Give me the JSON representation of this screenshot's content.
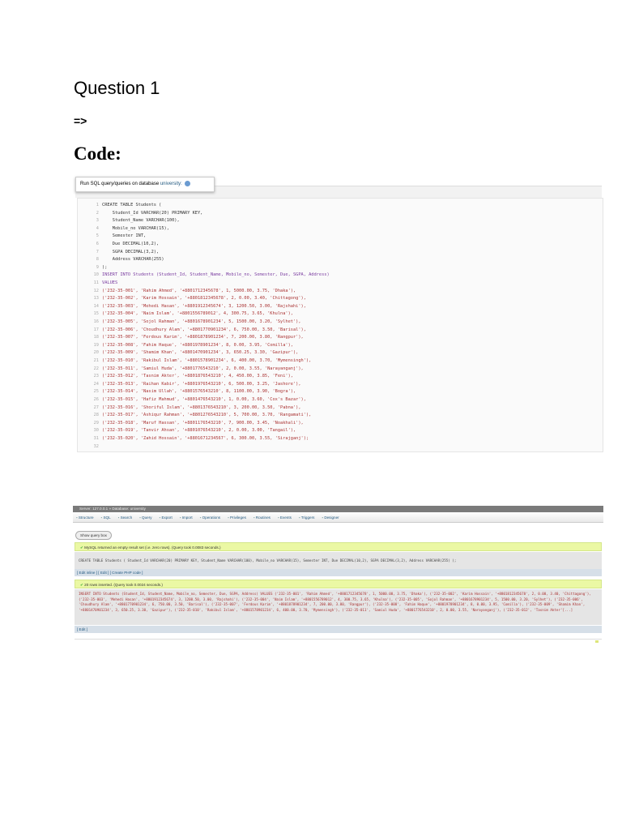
{
  "heading": "Question 1",
  "arrow": "=>",
  "code_heading": "Code:",
  "sql_panel": {
    "label": "Run SQL query/queries on database ",
    "db": "university:",
    "lines": [
      "CREATE TABLE Students (",
      "    Student_Id VARCHAR(20) PRIMARY KEY,",
      "    Student_Name VARCHAR(100),",
      "    Mobile_no VARCHAR(15),",
      "    Semester INT,",
      "    Due DECIMAL(10,2),",
      "    SGPA DECIMAL(3,2),",
      "    Address VARCHAR(255)",
      ");",
      "INSERT INTO Students (Student_Id, Student_Name, Mobile_no, Semester, Due, SGPA, Address)",
      "VALUES",
      "('232-35-001', 'Rahim Ahmed', '+8801712345678', 1, 5000.00, 3.75, 'Dhaka'),",
      "('232-35-002', 'Karim Hossain', '+8801812345678', 2, 0.00, 3.40, 'Chittagong'),",
      "('232-35-003', 'Mehedi Hasan', '+8801912345674', 3, 1200.50, 3.00, 'Rajshahi'),",
      "('232-35-004', 'Naim Islam', '+8801556789012', 4, 300.75, 3.65, 'Khulna'),",
      "('232-35-005', 'Sojol Rahman', '+8801678901234', 5, 1500.00, 3.20, 'Sylhet'),",
      "('232-35-006', 'Choudhury Alam', '+8801770901234', 6, 750.00, 3.50, 'Barisal'),",
      "('232-35-007', 'Ferdous Karim', '+8801878901234', 7, 200.00, 3.80, 'Rangpur'),",
      "('232-35-008', 'Fahim Haque', '+8801978901234', 8, 0.00, 3.95, 'Comilla'),",
      "('232-35-009', 'Shamim Khan', '+8801470901234', 3, 650.25, 3.30, 'Gazipur'),",
      "('232-35-010', 'Rakibul Islam', '+8801578901234', 6, 400.00, 3.70, 'Mymensingh'),",
      "('232-35-011', 'Samiul Huda', '+8801776543210', 2, 0.00, 3.55, 'Narayanganj'),",
      "('232-35-012', 'Tasnim Akter', '+8801876543210', 4, 450.00, 3.85, 'Feni'),",
      "('232-35-013', 'Raihan Kabir', '+8801976543210', 6, 500.00, 3.25, 'Jashore'),",
      "('232-35-014', 'Nasim Ullah', '+8801576543210', 8, 1100.00, 3.90, 'Bogra'),",
      "('232-35-015', 'Hafiz Mahmud', '+8801476543210', 1, 0.00, 3.60, 'Cox's Bazar'),",
      "('232-35-016', 'Shoriful Islam', '+8801376543210', 3, 200.00, 3.50, 'Pabna'),",
      "('232-35-017', 'Ashiqur Rahman', '+8801276543210', 5, 700.00, 3.70, 'Rangamati'),",
      "('232-35-018', 'Maruf Hassan', '+8801176543210', 7, 900.00, 3.45, 'Noakhali'),",
      "('232-35-019', 'Tanvir Ahsan', '+8801076543210', 2, 0.00, 3.00, 'Tangail'),",
      "('232-35-020', 'Zahid Hossain', '+8801671234567', 6, 300.00, 3.55, 'Sirajganj');",
      ""
    ]
  },
  "result_panel": {
    "title_bar": "Server: 127.0.0.1 » Database: university",
    "tabs": [
      "Structure",
      "SQL",
      "Search",
      "Query",
      "Export",
      "Import",
      "Operations",
      "Privileges",
      "Routines",
      "Events",
      "Triggers",
      "Designer"
    ],
    "show_query_box": "Show query box",
    "msg1": "MySQL returned an empty result set (i.e. zero rows). (Query took 0.0083 seconds.)",
    "create_sql": "CREATE TABLE Students ( Student_Id VARCHAR(20) PRIMARY KEY, Student_Name VARCHAR(100), Mobile_no VARCHAR(15), Semester INT, Due DECIMAL(10,2), SGPA DECIMAL(3,2), Address VARCHAR(255) );",
    "links1": "[ Edit inline ] [ Edit ] [ Create PHP code ]",
    "msg2": "20 rows inserted. (Query took 0.0024 seconds.)",
    "insert_sql": "INSERT INTO Students (Student_Id, Student_Name, Mobile_no, Semester, Due, SGPA, Address) VALUES ('232-35-001', 'Rahim Ahmed', '+8801712345678', 1, 5000.00, 3.75, 'Dhaka'), ('232-35-002', 'Karim Hossain', '+8801812345678', 2, 0.00, 3.40, 'Chittagong'), ('232-35-003', 'Mehedi Hasan', '+8801912345674', 3, 1200.50, 3.00, 'Rajshahi'), ('232-35-004', 'Naim Islam', '+8801556789012', 4, 300.75, 3.65, 'Khulna'), ('232-35-005', 'Sojol Rahman', '+8801678901234', 5, 1500.00, 3.20, 'Sylhet'), ('232-35-006', 'Choudhury Alam', '+8801770901234', 6, 750.00, 3.50, 'Barisal'), ('232-35-007', 'Ferdous Karim', '+8801878901234', 7, 200.00, 3.80, 'Rangpur'), ('232-35-008', 'Fahim Haque', '+8801978901234', 8, 0.00, 3.95, 'Comilla'), ('232-35-009', 'Shamim Khan', '+8801470901234', 3, 650.25, 3.30, 'Gazipur'), ('232-35-010', 'Rakibul Islam', '+8801578901234', 6, 400.00, 3.70, 'Mymensingh'), ('232-35-011', 'Samiul Huda', '+8801776543210', 2, 0.00, 3.55, 'Narayanganj'), ('232-35-012', 'Tasnim Akter'[...]",
    "links2": "[ Edit ]"
  }
}
